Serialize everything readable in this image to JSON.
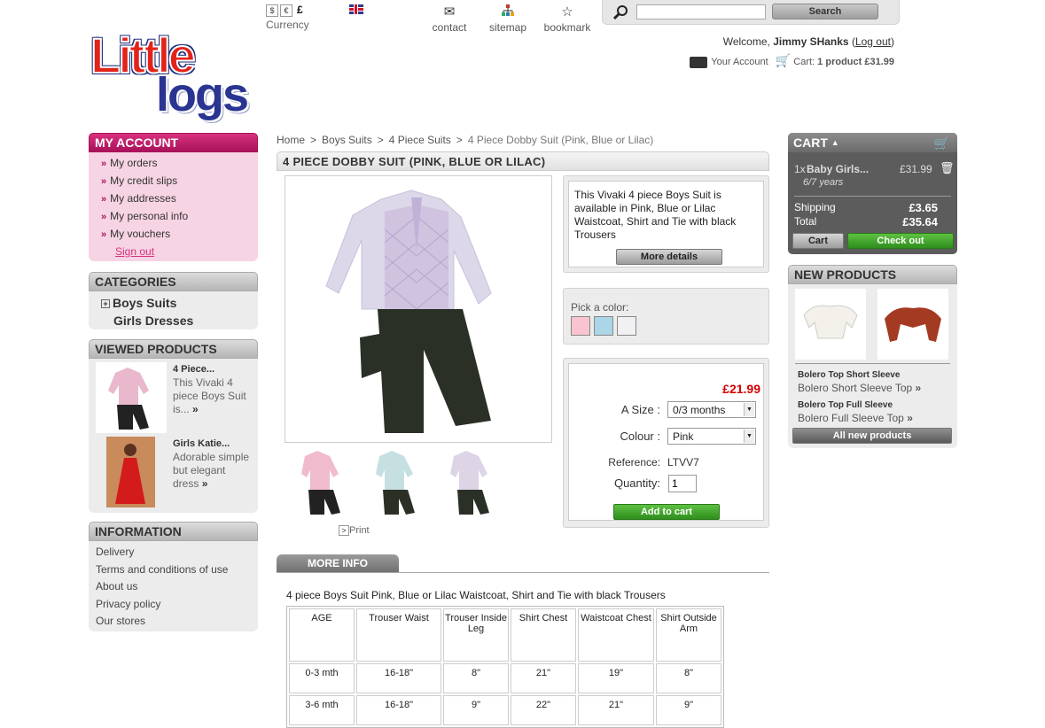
{
  "header": {
    "logo_top": "Little",
    "logo_bottom": "logs",
    "currency_label": "Currency",
    "currency_symbols": [
      "$",
      "€",
      "£"
    ],
    "contact": "contact",
    "sitemap": "sitemap",
    "bookmark": "bookmark",
    "search_placeholder": "",
    "search_button": "Search",
    "welcome_prefix": "Welcome,",
    "user_name": "Jimmy SHanks",
    "logout": "Log out",
    "your_account": "Your Account",
    "cart_label": "Cart:",
    "cart_summary": "1 product £31.99"
  },
  "account": {
    "title": "MY ACCOUNT",
    "items": [
      "My orders",
      "My credit slips",
      "My addresses",
      "My personal info",
      "My vouchers"
    ],
    "signout": "Sign out"
  },
  "categories": {
    "title": "CATEGORIES",
    "items": [
      "Boys Suits",
      "Girls Dresses"
    ],
    "expander": "+"
  },
  "viewed": {
    "title": "VIEWED PRODUCTS",
    "items": [
      {
        "name": "4 Piece...",
        "desc": "This Vivaki 4 piece Boys Suit is...",
        "more": "»"
      },
      {
        "name": "Girls Katie...",
        "desc": "Adorable simple but elegant dress",
        "more": "»"
      }
    ]
  },
  "information": {
    "title": "INFORMATION",
    "items": [
      "Delivery",
      "Terms and conditions of use",
      "About us",
      "Privacy policy",
      "Our stores"
    ]
  },
  "breadcrumb": [
    "Home",
    "Boys Suits",
    "4 Piece Suits",
    "4 Piece Dobby Suit (Pink, Blue or Lilac)"
  ],
  "product": {
    "title": "4 PIECE DOBBY SUIT (PINK, BLUE OR LILAC)",
    "short_desc": "This Vivaki 4 piece Boys Suit is available in Pink, Blue or Lilac Waistcoat, Shirt and Tie with black Trousers",
    "more_details": "More details",
    "pick_color": "Pick a color:",
    "colors": [
      "#f9c3cf",
      "#aad6e7",
      "#f1f0f2"
    ],
    "price": "£21.99",
    "size_label": "A Size :",
    "size_value": "0/3 months",
    "colour_label": "Colour :",
    "colour_value": "Pink",
    "reference_label": "Reference:",
    "reference_value": "LTVV7",
    "quantity_label": "Quantity:",
    "quantity_value": "1",
    "add_to_cart": "Add to cart",
    "print": "Print"
  },
  "more_info": {
    "tab": "MORE INFO",
    "intro": "4 piece Boys Suit Pink, Blue or Lilac Waistcoat, Shirt and Tie with black Trousers",
    "headers": [
      "AGE",
      "Trouser Waist",
      "Trouser Inside Leg",
      "Shirt Chest",
      "Waistcoat Chest",
      "Shirt Outside Arm"
    ],
    "rows": [
      [
        "0-3 mth",
        "16-18\"",
        "8\"",
        "21\"",
        "19\"",
        "8\""
      ],
      [
        "3-6 mth",
        "16-18\"",
        "9\"",
        "22\"",
        "21\"",
        "9\""
      ]
    ]
  },
  "cart": {
    "title": "CART",
    "item_qty": "1x",
    "item_name": "Baby Girls...",
    "item_price": "£31.99",
    "item_attr": "6/7 years",
    "shipping_label": "Shipping",
    "shipping_value": "£3.65",
    "total_label": "Total",
    "total_value": "£35.64",
    "cart_button": "Cart",
    "checkout_button": "Check out"
  },
  "new_products": {
    "title": "NEW PRODUCTS",
    "items": [
      {
        "name": "Bolero Top Short Sleeve",
        "desc": "Bolero Short Sleeve Top"
      },
      {
        "name": "Bolero Top Full Sleeve",
        "desc": "Bolero Full Sleeve Top"
      }
    ],
    "all_button": "All new products"
  }
}
